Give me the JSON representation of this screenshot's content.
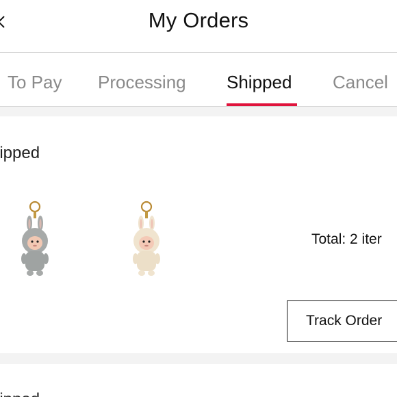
{
  "header": {
    "title": "My Orders",
    "back_icon": "chevron-left-icon"
  },
  "tabs": [
    {
      "label": "To Pay",
      "active": false
    },
    {
      "label": "Processing",
      "active": false
    },
    {
      "label": "Shipped",
      "active": true
    },
    {
      "label": "Cancel",
      "active": false
    }
  ],
  "colors": {
    "accent": "#e0143c",
    "inactive_tab": "#8a8a8a",
    "separator": "#f3f3f3"
  },
  "order": {
    "status": "hipped",
    "products": [
      {
        "name": "gray-plush-keychain",
        "color": "#a7aaa9"
      },
      {
        "name": "beige-plush-keychain",
        "color": "#f0e4cf"
      }
    ],
    "total": "Total: 2 iter",
    "track_label": "Track Order"
  },
  "next_order": {
    "status": "hipped"
  }
}
